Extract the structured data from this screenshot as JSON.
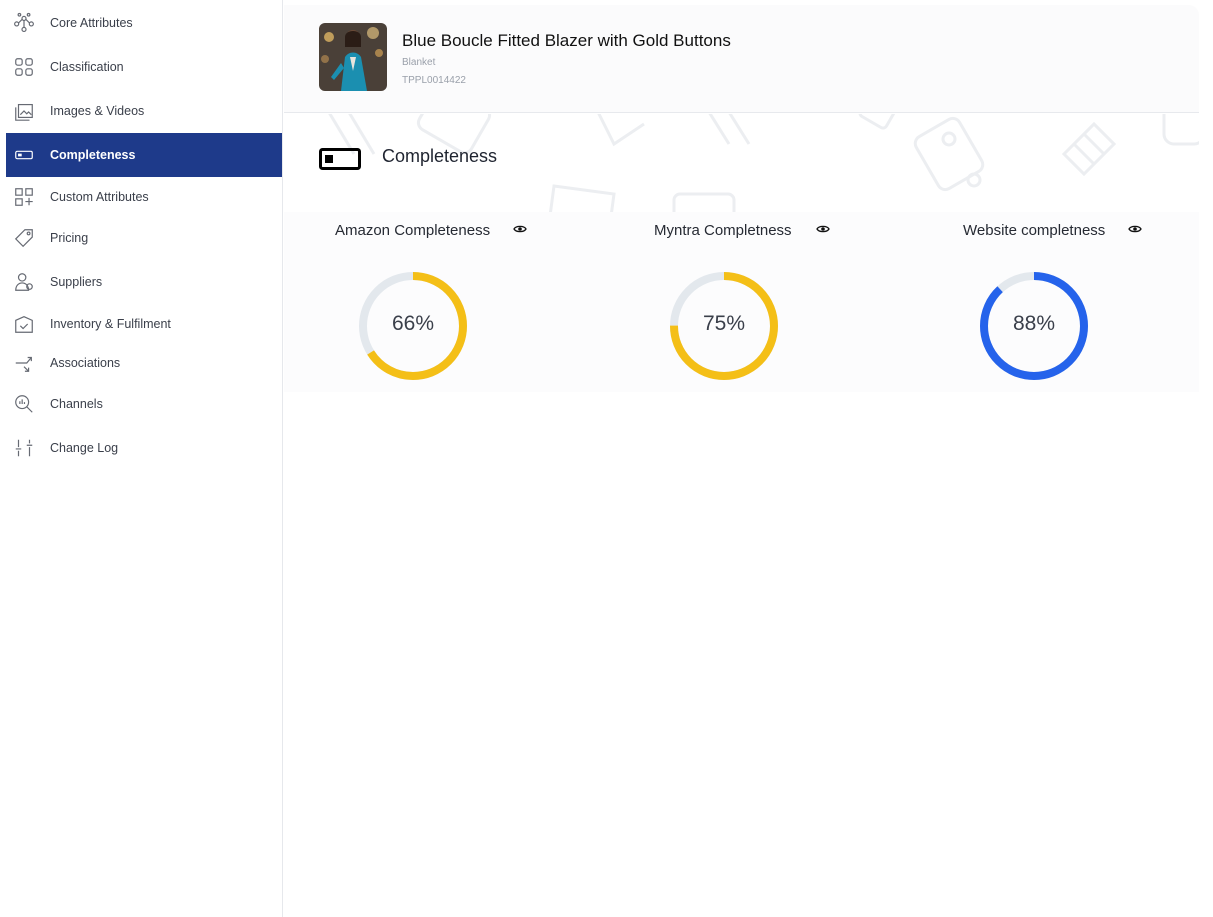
{
  "sidebar": {
    "items": [
      {
        "label": "Core Attributes",
        "icon": "molecule-icon",
        "active": false
      },
      {
        "label": "Classification",
        "icon": "grid-icon",
        "active": false
      },
      {
        "label": "Images & Videos",
        "icon": "gallery-icon",
        "active": false
      },
      {
        "label": "Completeness",
        "icon": "battery-icon",
        "active": true
      },
      {
        "label": "Custom Attributes",
        "icon": "grid-plus-icon",
        "active": false
      },
      {
        "label": "Pricing",
        "icon": "tag-icon",
        "active": false
      },
      {
        "label": "Suppliers",
        "icon": "user-icon",
        "active": false
      },
      {
        "label": "Inventory & Fulfilment",
        "icon": "warehouse-icon",
        "active": false
      },
      {
        "label": "Associations",
        "icon": "arrows-icon",
        "active": false
      },
      {
        "label": "Channels",
        "icon": "magnify-chart-icon",
        "active": false
      },
      {
        "label": "Change Log",
        "icon": "sliders-icon",
        "active": false
      }
    ]
  },
  "product": {
    "title": "Blue Boucle Fitted Blazer with Gold Buttons",
    "category": "Blanket",
    "sku": "TPPL0014422"
  },
  "section": {
    "title": "Completeness"
  },
  "cards": [
    {
      "title": "Amazon Completeness",
      "percent": 66,
      "label": "66%",
      "color": "#f4bf17"
    },
    {
      "title": "Myntra Completness",
      "percent": 75,
      "label": "75%",
      "color": "#f4bf17"
    },
    {
      "title": "Website completness",
      "percent": 88,
      "label": "88%",
      "color": "#2563eb"
    }
  ],
  "colors": {
    "active_nav": "#1e3a8a",
    "track": "#e3e8ed"
  }
}
